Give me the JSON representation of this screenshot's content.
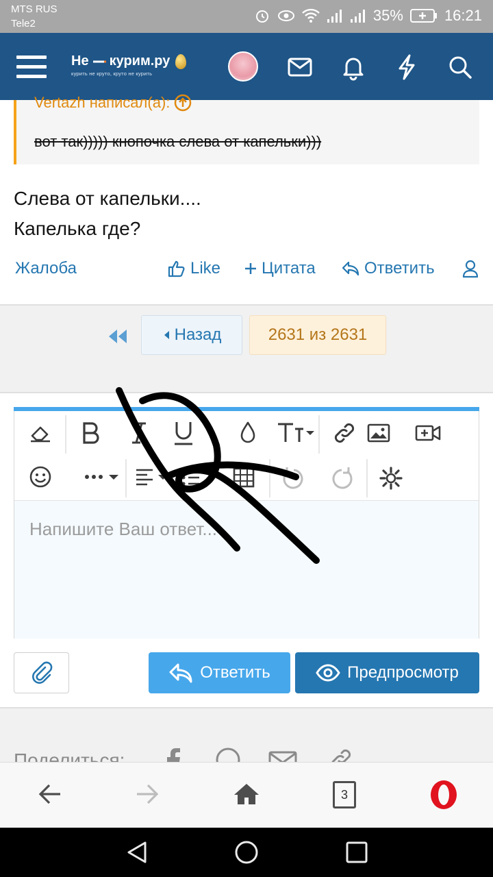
{
  "status_bar": {
    "carrier1": "MTS RUS",
    "carrier2": "Tele2",
    "battery": "35%",
    "time": "16:21"
  },
  "header": {
    "logo_main": "Не",
    "logo_main2": "курим.ру",
    "logo_tag": "курить не круто, круто не курить",
    "icons": [
      "menu-icon",
      "avatar",
      "mail-icon",
      "bell-icon",
      "bolt-icon",
      "search-icon"
    ]
  },
  "quote": {
    "author": "Vertazh написал(а):",
    "text": "вот так))))) кнопочка слева от капельки)))"
  },
  "post": {
    "line1": "Слева от капельки....",
    "line2": "Капелька где?"
  },
  "actions": {
    "report": "Жалоба",
    "like": "Like",
    "quote": "Цитата",
    "reply": "Ответить"
  },
  "pagination": {
    "back": "Назад",
    "current": "2631 из 2631"
  },
  "editor": {
    "placeholder": "Напишите Ваш ответ..."
  },
  "buttons": {
    "reply": "Ответить",
    "preview": "Предпросмотр"
  },
  "share": {
    "label": "Поделиться:"
  },
  "browser": {
    "tabs": "3"
  },
  "colors": {
    "header": "#1f5587",
    "link": "#2577b1",
    "accent": "#47a7eb",
    "quote_bar": "#f5a31a"
  }
}
